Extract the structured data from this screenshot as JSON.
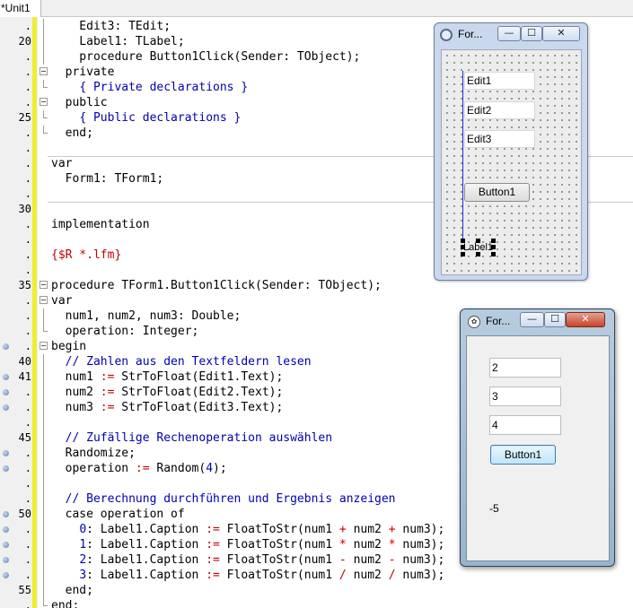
{
  "tab": {
    "label": "*Unit1"
  },
  "editor": {
    "lines": [
      {
        "num": ".",
        "bp": false,
        "fold": "line",
        "tokens": [
          [
            "    Edit3: TEdit;",
            "kw"
          ]
        ]
      },
      {
        "num": "20",
        "bp": false,
        "fold": "line",
        "tokens": [
          [
            "    Label1: TLabel;",
            "kw"
          ]
        ]
      },
      {
        "num": ".",
        "bp": false,
        "fold": "line",
        "tokens": [
          [
            "    procedure Button1Click(Sender: TObject);",
            "kw"
          ]
        ]
      },
      {
        "num": ".",
        "bp": false,
        "fold": "box",
        "tokens": [
          [
            "  private",
            "kw"
          ]
        ]
      },
      {
        "num": ".",
        "bp": false,
        "fold": "end",
        "tokens": [
          [
            "    ",
            "kw"
          ],
          [
            "{ Private declarations }",
            "cm"
          ]
        ]
      },
      {
        "num": ".",
        "bp": false,
        "fold": "box",
        "tokens": [
          [
            "  public",
            "kw"
          ]
        ]
      },
      {
        "num": "25",
        "bp": false,
        "fold": "end",
        "tokens": [
          [
            "    ",
            "kw"
          ],
          [
            "{ Public declarations }",
            "cm"
          ]
        ]
      },
      {
        "num": ".",
        "bp": false,
        "fold": "end",
        "tokens": [
          [
            "  end;",
            "kw"
          ]
        ]
      },
      {
        "num": ".",
        "bp": false,
        "fold": "none",
        "tokens": [
          [
            "",
            "kw"
          ]
        ]
      },
      {
        "num": ".",
        "bp": false,
        "fold": "none",
        "tokens": [
          [
            "var",
            "kw"
          ]
        ]
      },
      {
        "num": ".",
        "bp": false,
        "fold": "none",
        "tokens": [
          [
            "  Form1: TForm1;",
            "kw"
          ]
        ]
      },
      {
        "num": ".",
        "bp": false,
        "fold": "none",
        "tokens": [
          [
            "",
            "kw"
          ]
        ]
      },
      {
        "num": "30",
        "bp": false,
        "fold": "none",
        "tokens": [
          [
            "",
            "kw"
          ]
        ]
      },
      {
        "num": ".",
        "bp": false,
        "fold": "none",
        "tokens": [
          [
            "implementation",
            "kw"
          ]
        ]
      },
      {
        "num": ".",
        "bp": false,
        "fold": "none",
        "tokens": [
          [
            "",
            "kw"
          ]
        ]
      },
      {
        "num": ".",
        "bp": false,
        "fold": "none",
        "tokens": [
          [
            "{$R *.lfm}",
            "dir"
          ]
        ]
      },
      {
        "num": ".",
        "bp": false,
        "fold": "none",
        "tokens": [
          [
            "",
            "kw"
          ]
        ]
      },
      {
        "num": "35",
        "bp": false,
        "fold": "box",
        "tokens": [
          [
            "procedure TForm1.Button1Click(Sender: TObject);",
            "kw"
          ]
        ]
      },
      {
        "num": ".",
        "bp": false,
        "fold": "box",
        "tokens": [
          [
            "var",
            "kw"
          ]
        ]
      },
      {
        "num": ".",
        "bp": false,
        "fold": "line",
        "tokens": [
          [
            "  num1, num2, num3: Double;",
            "kw"
          ]
        ]
      },
      {
        "num": ".",
        "bp": false,
        "fold": "end",
        "tokens": [
          [
            "  operation: Integer;",
            "kw"
          ]
        ]
      },
      {
        "num": ".",
        "bp": true,
        "fold": "box",
        "tokens": [
          [
            "begin",
            "kw"
          ]
        ]
      },
      {
        "num": "40",
        "bp": false,
        "fold": "line",
        "tokens": [
          [
            "  ",
            "kw"
          ],
          [
            "// Zahlen aus den Textfeldern lesen",
            "cm"
          ]
        ]
      },
      {
        "num": "41",
        "bp": true,
        "fold": "line",
        "tokens": [
          [
            "  num1 ",
            "kw"
          ],
          [
            ":=",
            "sym"
          ],
          [
            " StrToFloat(Edit1.Text);",
            "kw"
          ]
        ]
      },
      {
        "num": ".",
        "bp": true,
        "fold": "line",
        "tokens": [
          [
            "  num2 ",
            "kw"
          ],
          [
            ":=",
            "sym"
          ],
          [
            " StrToFloat(Edit2.Text);",
            "kw"
          ]
        ]
      },
      {
        "num": ".",
        "bp": true,
        "fold": "line",
        "tokens": [
          [
            "  num3 ",
            "kw"
          ],
          [
            ":=",
            "sym"
          ],
          [
            " StrToFloat(Edit3.Text);",
            "kw"
          ]
        ]
      },
      {
        "num": ".",
        "bp": false,
        "fold": "line",
        "tokens": [
          [
            "",
            "kw"
          ]
        ]
      },
      {
        "num": "45",
        "bp": false,
        "fold": "line",
        "tokens": [
          [
            "  ",
            "kw"
          ],
          [
            "// Zufällige Rechenoperation auswählen",
            "cm"
          ]
        ]
      },
      {
        "num": ".",
        "bp": true,
        "fold": "line",
        "tokens": [
          [
            "  Randomize;",
            "kw"
          ]
        ]
      },
      {
        "num": ".",
        "bp": true,
        "fold": "line",
        "tokens": [
          [
            "  operation ",
            "kw"
          ],
          [
            ":=",
            "sym"
          ],
          [
            " Random(",
            "kw"
          ],
          [
            "4",
            "num"
          ],
          [
            ");",
            "kw"
          ]
        ]
      },
      {
        "num": ".",
        "bp": false,
        "fold": "line",
        "tokens": [
          [
            "",
            "kw"
          ]
        ]
      },
      {
        "num": ".",
        "bp": false,
        "fold": "line",
        "tokens": [
          [
            "  ",
            "kw"
          ],
          [
            "// Berechnung durchführen und Ergebnis anzeigen",
            "cm"
          ]
        ]
      },
      {
        "num": "50",
        "bp": true,
        "fold": "line",
        "tokens": [
          [
            "  case operation of",
            "kw"
          ]
        ]
      },
      {
        "num": ".",
        "bp": true,
        "fold": "line",
        "tokens": [
          [
            "    ",
            "kw"
          ],
          [
            "0",
            "num"
          ],
          [
            ": Label1.Caption ",
            "kw"
          ],
          [
            ":=",
            "sym"
          ],
          [
            " FloatToStr(num1 ",
            "kw"
          ],
          [
            "+",
            "sym"
          ],
          [
            " num2 ",
            "kw"
          ],
          [
            "+",
            "sym"
          ],
          [
            " num3);",
            "kw"
          ]
        ]
      },
      {
        "num": ".",
        "bp": true,
        "fold": "line",
        "tokens": [
          [
            "    ",
            "kw"
          ],
          [
            "1",
            "num"
          ],
          [
            ": Label1.Caption ",
            "kw"
          ],
          [
            ":=",
            "sym"
          ],
          [
            " FloatToStr(num1 ",
            "kw"
          ],
          [
            "*",
            "sym"
          ],
          [
            " num2 ",
            "kw"
          ],
          [
            "*",
            "sym"
          ],
          [
            " num3);",
            "kw"
          ]
        ]
      },
      {
        "num": ".",
        "bp": true,
        "fold": "line",
        "tokens": [
          [
            "    ",
            "kw"
          ],
          [
            "2",
            "num"
          ],
          [
            ": Label1.Caption ",
            "kw"
          ],
          [
            ":=",
            "sym"
          ],
          [
            " FloatToStr(num1 ",
            "kw"
          ],
          [
            "-",
            "sym"
          ],
          [
            " num2 ",
            "kw"
          ],
          [
            "-",
            "sym"
          ],
          [
            " num3);",
            "kw"
          ]
        ]
      },
      {
        "num": ".",
        "bp": true,
        "fold": "line",
        "tokens": [
          [
            "    ",
            "kw"
          ],
          [
            "3",
            "num"
          ],
          [
            ": Label1.Caption ",
            "kw"
          ],
          [
            ":=",
            "sym"
          ],
          [
            " FloatToStr(num1 ",
            "kw"
          ],
          [
            "/",
            "sym"
          ],
          [
            " num2 ",
            "kw"
          ],
          [
            "/",
            "sym"
          ],
          [
            " num3);",
            "kw"
          ]
        ]
      },
      {
        "num": "55",
        "bp": false,
        "fold": "line",
        "tokens": [
          [
            "  end;",
            "kw"
          ]
        ]
      },
      {
        "num": ".",
        "bp": false,
        "fold": "end",
        "tokens": [
          [
            "end;",
            "kw"
          ]
        ]
      }
    ]
  },
  "design_form": {
    "title": "For...",
    "min_glyph": "—",
    "max_glyph": "☐",
    "close_glyph": "✕",
    "edit1_text": "Edit1",
    "edit2_text": "Edit2",
    "edit3_text": "Edit3",
    "button_label": "Button1",
    "label_caption": "Label1"
  },
  "run_form": {
    "title": "For...",
    "min_glyph": "—",
    "max_glyph": "☐",
    "close_glyph": "✕",
    "edit1_value": "2",
    "edit2_value": "3",
    "edit3_value": "4",
    "button_label": "Button1",
    "result_caption": "-5"
  }
}
